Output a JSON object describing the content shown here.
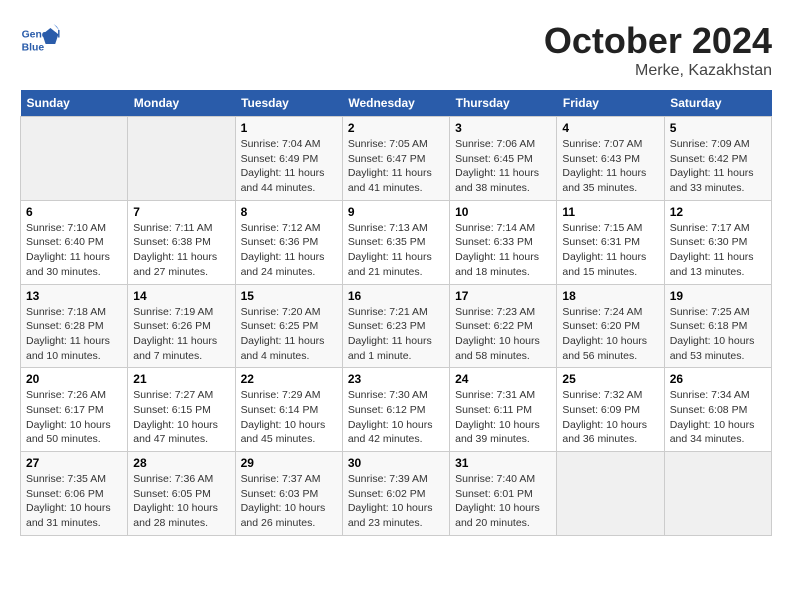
{
  "header": {
    "logo_text_general": "General",
    "logo_text_blue": "Blue",
    "month": "October 2024",
    "location": "Merke, Kazakhstan"
  },
  "weekdays": [
    "Sunday",
    "Monday",
    "Tuesday",
    "Wednesday",
    "Thursday",
    "Friday",
    "Saturday"
  ],
  "weeks": [
    [
      {
        "day": "",
        "info": ""
      },
      {
        "day": "",
        "info": ""
      },
      {
        "day": "1",
        "info": "Sunrise: 7:04 AM\nSunset: 6:49 PM\nDaylight: 11 hours and 44 minutes."
      },
      {
        "day": "2",
        "info": "Sunrise: 7:05 AM\nSunset: 6:47 PM\nDaylight: 11 hours and 41 minutes."
      },
      {
        "day": "3",
        "info": "Sunrise: 7:06 AM\nSunset: 6:45 PM\nDaylight: 11 hours and 38 minutes."
      },
      {
        "day": "4",
        "info": "Sunrise: 7:07 AM\nSunset: 6:43 PM\nDaylight: 11 hours and 35 minutes."
      },
      {
        "day": "5",
        "info": "Sunrise: 7:09 AM\nSunset: 6:42 PM\nDaylight: 11 hours and 33 minutes."
      }
    ],
    [
      {
        "day": "6",
        "info": "Sunrise: 7:10 AM\nSunset: 6:40 PM\nDaylight: 11 hours and 30 minutes."
      },
      {
        "day": "7",
        "info": "Sunrise: 7:11 AM\nSunset: 6:38 PM\nDaylight: 11 hours and 27 minutes."
      },
      {
        "day": "8",
        "info": "Sunrise: 7:12 AM\nSunset: 6:36 PM\nDaylight: 11 hours and 24 minutes."
      },
      {
        "day": "9",
        "info": "Sunrise: 7:13 AM\nSunset: 6:35 PM\nDaylight: 11 hours and 21 minutes."
      },
      {
        "day": "10",
        "info": "Sunrise: 7:14 AM\nSunset: 6:33 PM\nDaylight: 11 hours and 18 minutes."
      },
      {
        "day": "11",
        "info": "Sunrise: 7:15 AM\nSunset: 6:31 PM\nDaylight: 11 hours and 15 minutes."
      },
      {
        "day": "12",
        "info": "Sunrise: 7:17 AM\nSunset: 6:30 PM\nDaylight: 11 hours and 13 minutes."
      }
    ],
    [
      {
        "day": "13",
        "info": "Sunrise: 7:18 AM\nSunset: 6:28 PM\nDaylight: 11 hours and 10 minutes."
      },
      {
        "day": "14",
        "info": "Sunrise: 7:19 AM\nSunset: 6:26 PM\nDaylight: 11 hours and 7 minutes."
      },
      {
        "day": "15",
        "info": "Sunrise: 7:20 AM\nSunset: 6:25 PM\nDaylight: 11 hours and 4 minutes."
      },
      {
        "day": "16",
        "info": "Sunrise: 7:21 AM\nSunset: 6:23 PM\nDaylight: 11 hours and 1 minute."
      },
      {
        "day": "17",
        "info": "Sunrise: 7:23 AM\nSunset: 6:22 PM\nDaylight: 10 hours and 58 minutes."
      },
      {
        "day": "18",
        "info": "Sunrise: 7:24 AM\nSunset: 6:20 PM\nDaylight: 10 hours and 56 minutes."
      },
      {
        "day": "19",
        "info": "Sunrise: 7:25 AM\nSunset: 6:18 PM\nDaylight: 10 hours and 53 minutes."
      }
    ],
    [
      {
        "day": "20",
        "info": "Sunrise: 7:26 AM\nSunset: 6:17 PM\nDaylight: 10 hours and 50 minutes."
      },
      {
        "day": "21",
        "info": "Sunrise: 7:27 AM\nSunset: 6:15 PM\nDaylight: 10 hours and 47 minutes."
      },
      {
        "day": "22",
        "info": "Sunrise: 7:29 AM\nSunset: 6:14 PM\nDaylight: 10 hours and 45 minutes."
      },
      {
        "day": "23",
        "info": "Sunrise: 7:30 AM\nSunset: 6:12 PM\nDaylight: 10 hours and 42 minutes."
      },
      {
        "day": "24",
        "info": "Sunrise: 7:31 AM\nSunset: 6:11 PM\nDaylight: 10 hours and 39 minutes."
      },
      {
        "day": "25",
        "info": "Sunrise: 7:32 AM\nSunset: 6:09 PM\nDaylight: 10 hours and 36 minutes."
      },
      {
        "day": "26",
        "info": "Sunrise: 7:34 AM\nSunset: 6:08 PM\nDaylight: 10 hours and 34 minutes."
      }
    ],
    [
      {
        "day": "27",
        "info": "Sunrise: 7:35 AM\nSunset: 6:06 PM\nDaylight: 10 hours and 31 minutes."
      },
      {
        "day": "28",
        "info": "Sunrise: 7:36 AM\nSunset: 6:05 PM\nDaylight: 10 hours and 28 minutes."
      },
      {
        "day": "29",
        "info": "Sunrise: 7:37 AM\nSunset: 6:03 PM\nDaylight: 10 hours and 26 minutes."
      },
      {
        "day": "30",
        "info": "Sunrise: 7:39 AM\nSunset: 6:02 PM\nDaylight: 10 hours and 23 minutes."
      },
      {
        "day": "31",
        "info": "Sunrise: 7:40 AM\nSunset: 6:01 PM\nDaylight: 10 hours and 20 minutes."
      },
      {
        "day": "",
        "info": ""
      },
      {
        "day": "",
        "info": ""
      }
    ]
  ]
}
